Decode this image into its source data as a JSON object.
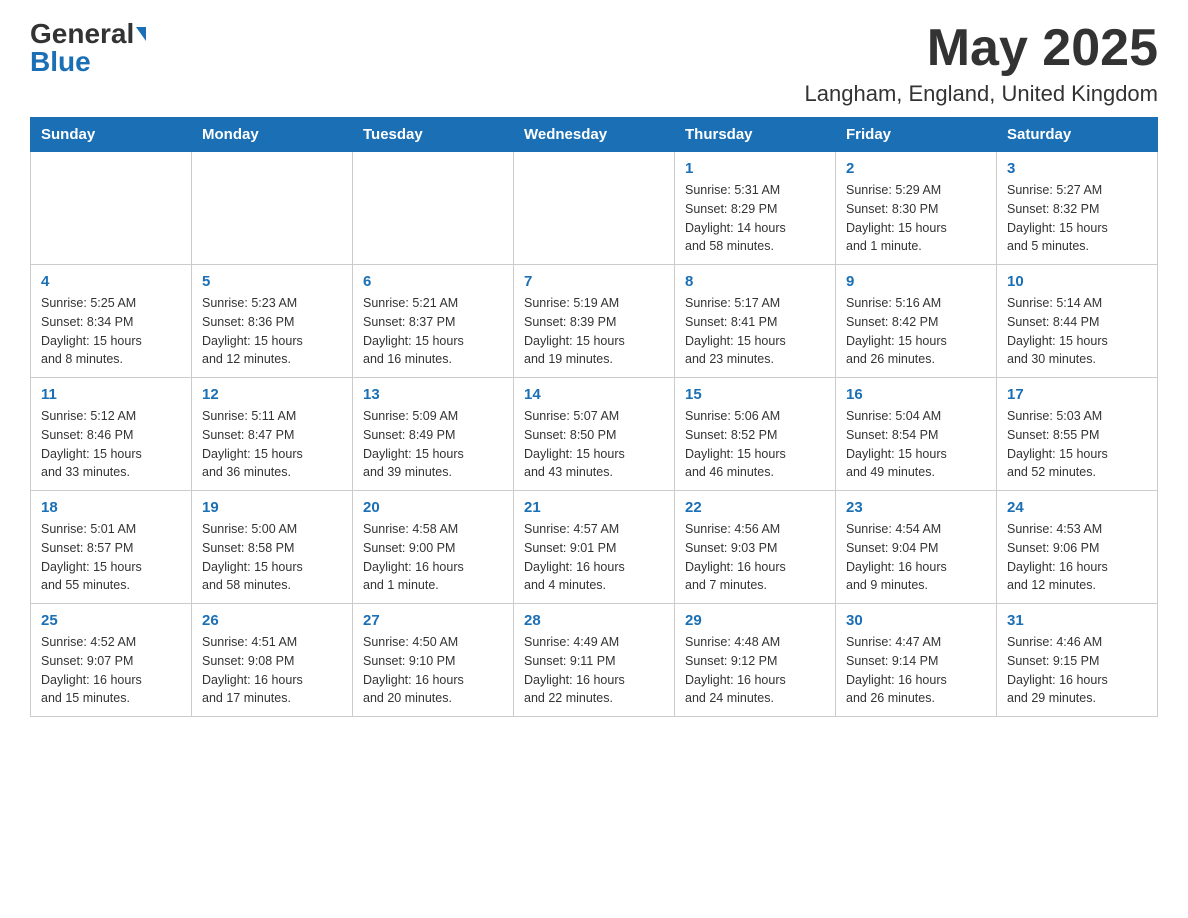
{
  "header": {
    "logo_general": "General",
    "logo_blue": "Blue",
    "title": "May 2025",
    "location": "Langham, England, United Kingdom"
  },
  "days_of_week": [
    "Sunday",
    "Monday",
    "Tuesday",
    "Wednesday",
    "Thursday",
    "Friday",
    "Saturday"
  ],
  "weeks": [
    [
      {
        "day": "",
        "info": ""
      },
      {
        "day": "",
        "info": ""
      },
      {
        "day": "",
        "info": ""
      },
      {
        "day": "",
        "info": ""
      },
      {
        "day": "1",
        "info": "Sunrise: 5:31 AM\nSunset: 8:29 PM\nDaylight: 14 hours\nand 58 minutes."
      },
      {
        "day": "2",
        "info": "Sunrise: 5:29 AM\nSunset: 8:30 PM\nDaylight: 15 hours\nand 1 minute."
      },
      {
        "day": "3",
        "info": "Sunrise: 5:27 AM\nSunset: 8:32 PM\nDaylight: 15 hours\nand 5 minutes."
      }
    ],
    [
      {
        "day": "4",
        "info": "Sunrise: 5:25 AM\nSunset: 8:34 PM\nDaylight: 15 hours\nand 8 minutes."
      },
      {
        "day": "5",
        "info": "Sunrise: 5:23 AM\nSunset: 8:36 PM\nDaylight: 15 hours\nand 12 minutes."
      },
      {
        "day": "6",
        "info": "Sunrise: 5:21 AM\nSunset: 8:37 PM\nDaylight: 15 hours\nand 16 minutes."
      },
      {
        "day": "7",
        "info": "Sunrise: 5:19 AM\nSunset: 8:39 PM\nDaylight: 15 hours\nand 19 minutes."
      },
      {
        "day": "8",
        "info": "Sunrise: 5:17 AM\nSunset: 8:41 PM\nDaylight: 15 hours\nand 23 minutes."
      },
      {
        "day": "9",
        "info": "Sunrise: 5:16 AM\nSunset: 8:42 PM\nDaylight: 15 hours\nand 26 minutes."
      },
      {
        "day": "10",
        "info": "Sunrise: 5:14 AM\nSunset: 8:44 PM\nDaylight: 15 hours\nand 30 minutes."
      }
    ],
    [
      {
        "day": "11",
        "info": "Sunrise: 5:12 AM\nSunset: 8:46 PM\nDaylight: 15 hours\nand 33 minutes."
      },
      {
        "day": "12",
        "info": "Sunrise: 5:11 AM\nSunset: 8:47 PM\nDaylight: 15 hours\nand 36 minutes."
      },
      {
        "day": "13",
        "info": "Sunrise: 5:09 AM\nSunset: 8:49 PM\nDaylight: 15 hours\nand 39 minutes."
      },
      {
        "day": "14",
        "info": "Sunrise: 5:07 AM\nSunset: 8:50 PM\nDaylight: 15 hours\nand 43 minutes."
      },
      {
        "day": "15",
        "info": "Sunrise: 5:06 AM\nSunset: 8:52 PM\nDaylight: 15 hours\nand 46 minutes."
      },
      {
        "day": "16",
        "info": "Sunrise: 5:04 AM\nSunset: 8:54 PM\nDaylight: 15 hours\nand 49 minutes."
      },
      {
        "day": "17",
        "info": "Sunrise: 5:03 AM\nSunset: 8:55 PM\nDaylight: 15 hours\nand 52 minutes."
      }
    ],
    [
      {
        "day": "18",
        "info": "Sunrise: 5:01 AM\nSunset: 8:57 PM\nDaylight: 15 hours\nand 55 minutes."
      },
      {
        "day": "19",
        "info": "Sunrise: 5:00 AM\nSunset: 8:58 PM\nDaylight: 15 hours\nand 58 minutes."
      },
      {
        "day": "20",
        "info": "Sunrise: 4:58 AM\nSunset: 9:00 PM\nDaylight: 16 hours\nand 1 minute."
      },
      {
        "day": "21",
        "info": "Sunrise: 4:57 AM\nSunset: 9:01 PM\nDaylight: 16 hours\nand 4 minutes."
      },
      {
        "day": "22",
        "info": "Sunrise: 4:56 AM\nSunset: 9:03 PM\nDaylight: 16 hours\nand 7 minutes."
      },
      {
        "day": "23",
        "info": "Sunrise: 4:54 AM\nSunset: 9:04 PM\nDaylight: 16 hours\nand 9 minutes."
      },
      {
        "day": "24",
        "info": "Sunrise: 4:53 AM\nSunset: 9:06 PM\nDaylight: 16 hours\nand 12 minutes."
      }
    ],
    [
      {
        "day": "25",
        "info": "Sunrise: 4:52 AM\nSunset: 9:07 PM\nDaylight: 16 hours\nand 15 minutes."
      },
      {
        "day": "26",
        "info": "Sunrise: 4:51 AM\nSunset: 9:08 PM\nDaylight: 16 hours\nand 17 minutes."
      },
      {
        "day": "27",
        "info": "Sunrise: 4:50 AM\nSunset: 9:10 PM\nDaylight: 16 hours\nand 20 minutes."
      },
      {
        "day": "28",
        "info": "Sunrise: 4:49 AM\nSunset: 9:11 PM\nDaylight: 16 hours\nand 22 minutes."
      },
      {
        "day": "29",
        "info": "Sunrise: 4:48 AM\nSunset: 9:12 PM\nDaylight: 16 hours\nand 24 minutes."
      },
      {
        "day": "30",
        "info": "Sunrise: 4:47 AM\nSunset: 9:14 PM\nDaylight: 16 hours\nand 26 minutes."
      },
      {
        "day": "31",
        "info": "Sunrise: 4:46 AM\nSunset: 9:15 PM\nDaylight: 16 hours\nand 29 minutes."
      }
    ]
  ]
}
